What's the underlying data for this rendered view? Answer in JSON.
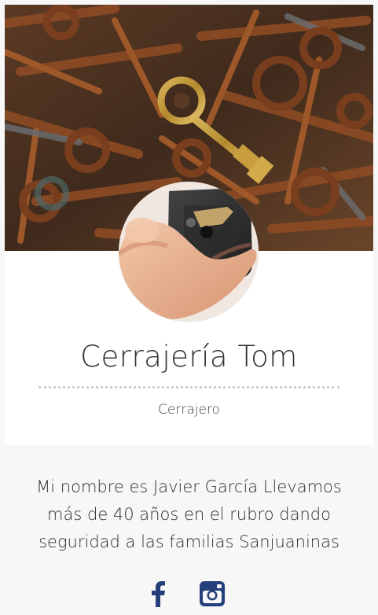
{
  "profile": {
    "name": "Cerrajería Tom",
    "role": "Cerrajero",
    "about": "Mi nombre es Javier García Llevamos más de 40 años en el rubro dando seguridad a las familias Sanjuaninas"
  },
  "media": {
    "cover_image": "rusty-keys-pile",
    "avatar_image": "hand-holding-lock-mechanism"
  },
  "social": {
    "facebook_icon": "facebook-icon",
    "instagram_icon": "instagram-icon"
  },
  "colors": {
    "page_bg": "#f7f7f7",
    "card_bg": "#ffffff",
    "text": "#2f2f2f",
    "divider": "#cfcfcf",
    "social_blue": "#243f7a"
  }
}
